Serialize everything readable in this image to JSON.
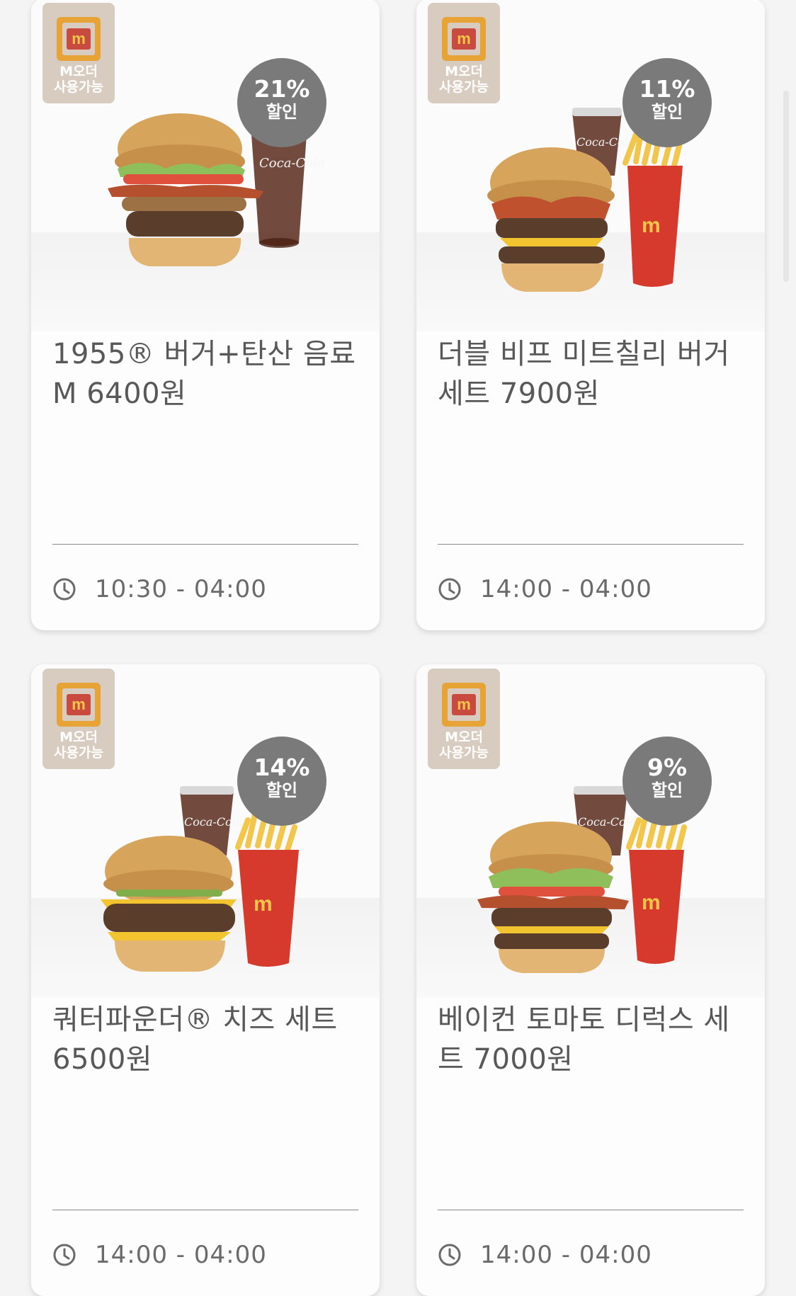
{
  "badge": {
    "label_line1": "M오더",
    "label_line2": "사용가능",
    "logo_letter": "m"
  },
  "cards": [
    {
      "discount_pct": "21%",
      "discount_label": "할인",
      "title": "1955® 버거+탄산 음료 M 6400원",
      "hours": "10:30 - 04:00",
      "image": {
        "items": [
          "burger",
          "cola"
        ]
      }
    },
    {
      "discount_pct": "11%",
      "discount_label": "할인",
      "title": "더블 비프 미트칠리 버거 세트 7900원",
      "hours": "14:00 - 04:00",
      "image": {
        "items": [
          "burger",
          "cola",
          "fries"
        ]
      }
    },
    {
      "discount_pct": "14%",
      "discount_label": "할인",
      "title": "쿼터파운더® 치즈 세트 6500원",
      "hours": "14:00 - 04:00",
      "image": {
        "items": [
          "burger",
          "cola",
          "fries"
        ]
      }
    },
    {
      "discount_pct": "9%",
      "discount_label": "할인",
      "title": "베이컨 토마토 디럭스 세트 7000원",
      "hours": "14:00 - 04:00",
      "image": {
        "items": [
          "burger",
          "cola",
          "fries"
        ]
      }
    }
  ],
  "colors": {
    "page_bg": "#f4f4f4",
    "card_bg": "#fdfdfd",
    "badge_bg": "#d8cbbf",
    "discount_bg": "#7a7a7a",
    "text": "#585858"
  }
}
